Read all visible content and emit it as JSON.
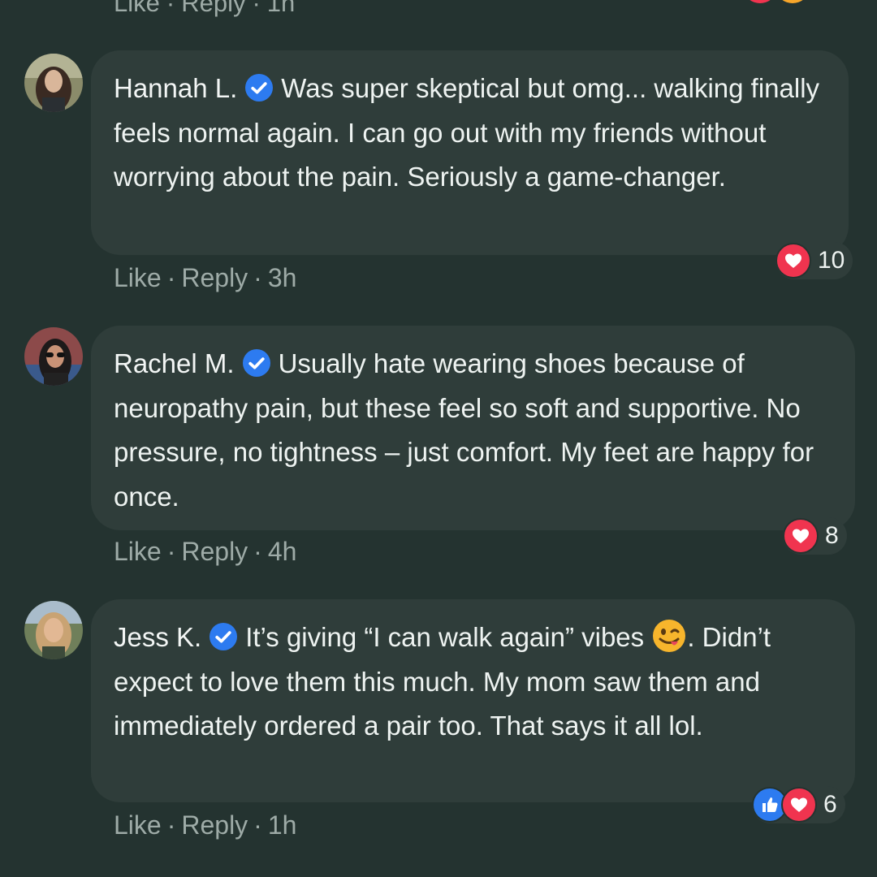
{
  "previous": {
    "like": "Like",
    "reply": "Reply",
    "time": "1h",
    "colors": [
      "#f0344f",
      "#f7a62a"
    ]
  },
  "comments": [
    {
      "author": "Hannah L.",
      "text": "Was super skeptical but omg... walking finally feels normal again. I can go out with my friends without worrying about the pain. Seriously a game-changer.",
      "like": "Like",
      "reply": "Reply",
      "time": "3h",
      "reactions": [
        "heart"
      ],
      "reaction_count": "10"
    },
    {
      "author": "Rachel M.",
      "text": "Usually hate wearing shoes because of neuropathy pain, but these feel so soft and supportive. No pressure, no tightness – just comfort. My feet are happy for once.",
      "like": "Like",
      "reply": "Reply",
      "time": "4h",
      "reactions": [
        "heart"
      ],
      "reaction_count": "8"
    },
    {
      "author": "Jess K.",
      "text_before_emoji": "It’s giving “I can walk again” vibes",
      "emoji": "winking-tongue-emoji",
      "text_after_emoji": ". Didn’t expect to love them this much. My mom saw them and immediately ordered a pair too. That says it all lol.",
      "like": "Like",
      "reply": "Reply",
      "time": "1h",
      "reactions": [
        "like",
        "heart"
      ],
      "reaction_count": "6"
    }
  ],
  "separator": "·",
  "colors": {
    "background": "#243330",
    "bubble": "#2f3d3a",
    "meta_text": "#9eaba7",
    "verified": "#2d7bf0",
    "heart": "#f0344f",
    "like": "#2d7bf0"
  }
}
